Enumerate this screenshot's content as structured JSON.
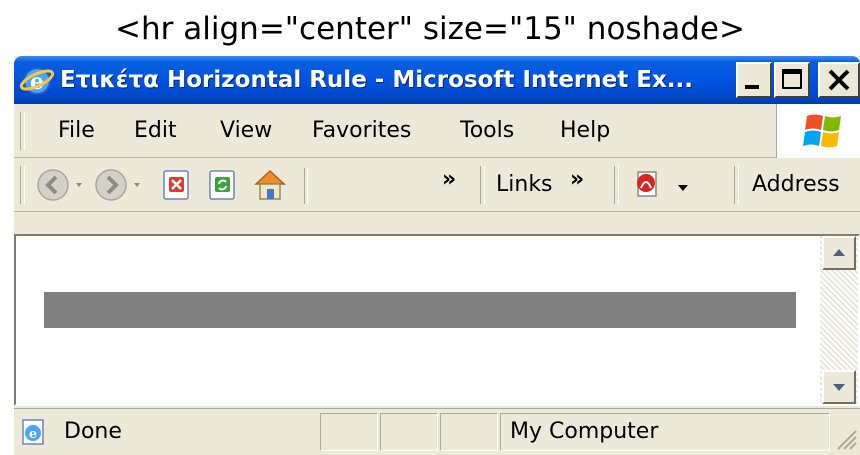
{
  "caption": "<hr align=\"center\" size=\"15\" noshade>",
  "window": {
    "title": "Ετικέτα Horizontal Rule - Microsoft Internet Ex...",
    "controls": [
      "minimize",
      "maximize",
      "close"
    ]
  },
  "menu": {
    "items": [
      "File",
      "Edit",
      "View",
      "Favorites",
      "Tools",
      "Help"
    ]
  },
  "toolbar": {
    "buttons": [
      "back-icon",
      "forward-icon",
      "stop-icon",
      "refresh-icon",
      "home-icon"
    ],
    "overflow": "»",
    "links_label": "Links",
    "links_overflow": "»",
    "address_label": "Address"
  },
  "content": {
    "hr": {
      "align": "center",
      "size": "15",
      "noshade": true,
      "color": "#808080"
    }
  },
  "status": {
    "text": "Done",
    "zone": "My Computer"
  },
  "colors": {
    "title_bar": "#0054e3",
    "chrome": "#ece9d8",
    "rule": "#808080"
  }
}
